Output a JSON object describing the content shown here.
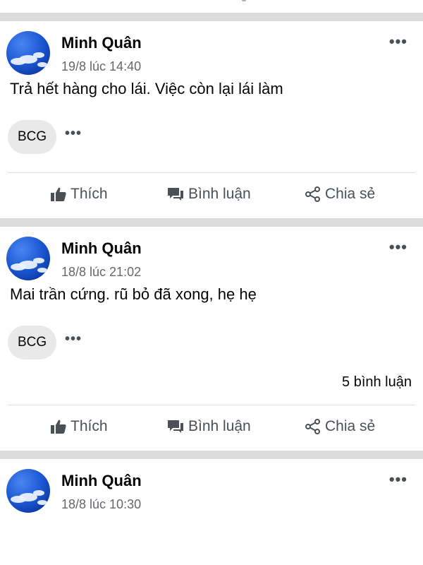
{
  "feed": {
    "posts": [
      {
        "author": "Minh Quân",
        "time": "19/8 lúc 14:40",
        "text": "Trả hết hàng cho lái. Việc còn lại lái làm",
        "tag": "BCG",
        "comments": ""
      },
      {
        "author": "Minh Quân",
        "time": "18/8 lúc 21:02",
        "text": "Mai trần cứng. rũ bỏ đã xong, hẹ hẹ",
        "tag": "BCG",
        "comments": "5 bình luận"
      },
      {
        "author": "Minh Quân",
        "time": "18/8 lúc 10:30"
      }
    ],
    "actions": {
      "like": "Thích",
      "comment": "Bình luận",
      "share": "Chia sẻ"
    },
    "more_glyph": "•••",
    "icons": [
      "thumbs-up-icon",
      "comment-icon",
      "share-icon",
      "more-icon"
    ],
    "colors": {
      "text": "#050505",
      "muted": "#65676b",
      "separator": "#dcdcdc",
      "chip": "#e9e9e9"
    }
  }
}
